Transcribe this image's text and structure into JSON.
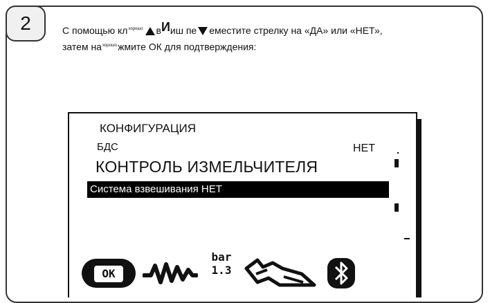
{
  "step": {
    "number": "2"
  },
  "instructions": {
    "line1_part1": "С помощью кл",
    "line1_small1": "хорошо",
    "line1_part2": "в",
    "line1_big": "И",
    "line1_part3": "иш пе",
    "line1_part4": "еместите стрелку на «ДА» или «НЕТ»,",
    "line2_part1": "затем на",
    "line2_small": "хорошо",
    "line2_part2": "жмите ОК для подтверждения:"
  },
  "lcd": {
    "title": "КОНФИГУРАЦИЯ",
    "bds_label": "БДС",
    "net_right": "НЕТ",
    "big_label": "КОНТРОЛЬ ИЗМЕЛЬЧИТЕЛЯ",
    "highlight_label": "Система взвешивания НЕТ"
  },
  "icons": {
    "ok_label": "OK",
    "bar_line1": "bar",
    "bar_line2": "1.3",
    "names": [
      "ok-button-icon",
      "wave-icon",
      "pressure-bar-icon",
      "tractor-icon",
      "bluetooth-icon"
    ]
  },
  "colors": {
    "frame_border": "#333333",
    "badge_bg": "#f0f0f0",
    "lcd_ink": "#111111",
    "highlight_bg": "#000000",
    "highlight_text": "#ffffff"
  }
}
